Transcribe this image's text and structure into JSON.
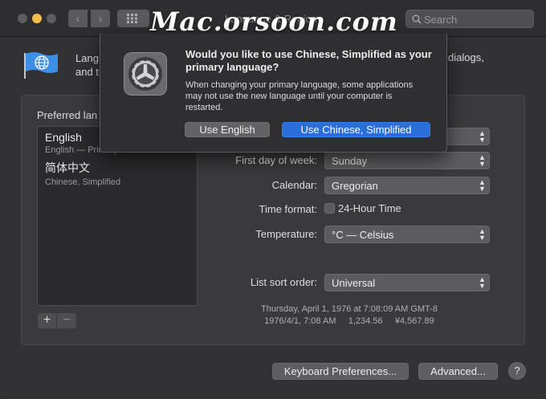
{
  "window": {
    "title": "Language & Region",
    "search_placeholder": "Search"
  },
  "watermark": "Mac.orsoon.com",
  "intro": {
    "left_text": "Lang and t",
    "right_text": "dialogs,"
  },
  "preferred_languages": {
    "label": "Preferred lan",
    "items": [
      {
        "name": "English",
        "sub": "English — Primary"
      },
      {
        "name": "简体中文",
        "sub": "Chinese, Simplified"
      }
    ],
    "add": "+",
    "remove": "−"
  },
  "settings": {
    "first_day_label": "First day of week:",
    "first_day_value": "Sunday",
    "calendar_label": "Calendar:",
    "calendar_value": "Gregorian",
    "time_format_label": "Time format:",
    "time_format_option": "24-Hour Time",
    "temperature_label": "Temperature:",
    "temperature_value": "°C — Celsius",
    "sort_label": "List sort order:",
    "sort_value": "Universal"
  },
  "sample": {
    "line1": "Thursday, April 1, 1976 at 7:08:09 AM GMT-8",
    "line2": "1976/4/1, 7:08 AM     1,234.56     ¥4,567.89"
  },
  "bottom": {
    "keyboard": "Keyboard Preferences...",
    "advanced": "Advanced...",
    "help": "?"
  },
  "sheet": {
    "title": "Would you like to use Chinese, Simplified as your primary language?",
    "body": "When changing your primary language, some applications may not use the new language until your computer is restarted.",
    "secondary_button": "Use English",
    "primary_button": "Use Chinese, Simplified"
  },
  "colors": {
    "accent": "#2a6fd9",
    "traffic_yellow": "#f5be4f"
  }
}
